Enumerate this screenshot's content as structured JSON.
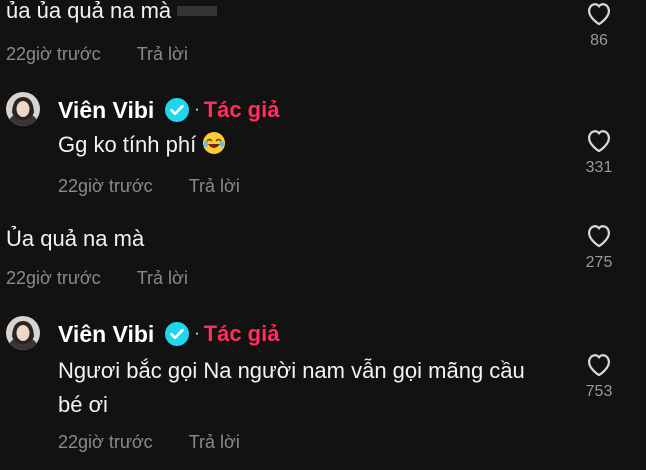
{
  "comments": [
    {
      "text": "ủa ủa quả na mà",
      "time": "22giờ trước",
      "reply": "Trả lời",
      "likes": "86"
    },
    {
      "author": "Viên Vibi",
      "badge": "Tác giả",
      "text": "Gg ko tính phí",
      "time": "22giờ trước",
      "reply": "Trả lời",
      "likes": "331"
    },
    {
      "text": "Ủa quả na mà",
      "time": "22giờ trước",
      "reply": "Trả lời",
      "likes": "275"
    },
    {
      "author": "Viên Vibi",
      "badge": "Tác giả",
      "text": "Ngươi bắc gọi Na người nam vẫn gọi mãng cầu bé ơi",
      "time": "22giờ trước",
      "reply": "Trả lời",
      "likes": "753"
    }
  ],
  "colors": {
    "background": "#121212",
    "author_badge": "#ff2e5a",
    "verified": "#20d5ec",
    "meta_text": "#8a8a8a"
  },
  "icons": [
    "heart-outline-icon",
    "verified-check-icon",
    "laughing-emoji-icon"
  ]
}
